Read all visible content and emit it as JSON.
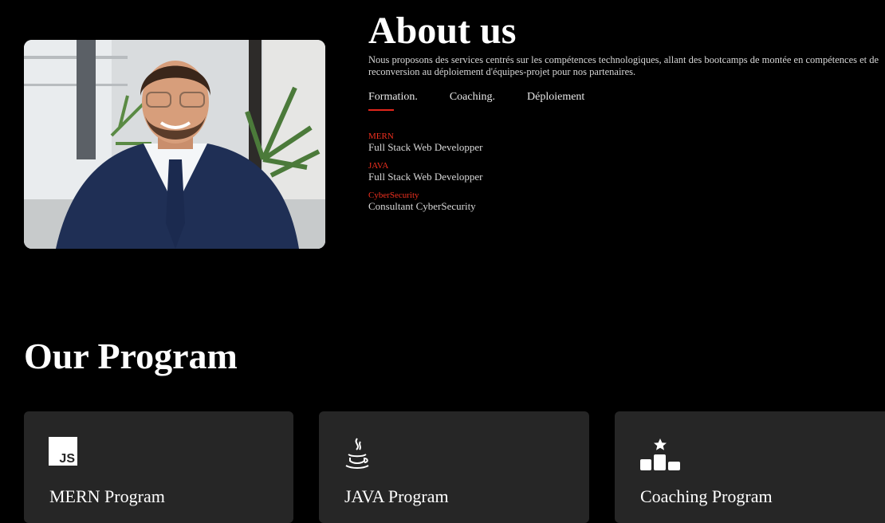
{
  "about": {
    "title": "About us",
    "description": "Nous proposons des services centrés sur les compétences technologiques, allant des bootcamps de montée en compétences et de reconversion au déploiement d'équipes-projet pour nos partenaires.",
    "tabs": [
      {
        "label": "Formation.",
        "active": true
      },
      {
        "label": "Coaching.",
        "active": false
      },
      {
        "label": "Déploiement",
        "active": false
      }
    ],
    "items": [
      {
        "tag": "MERN",
        "name": "Full Stack Web Developper"
      },
      {
        "tag": "JAVA",
        "name": "Full Stack Web Developper"
      },
      {
        "tag": "CyberSecurity",
        "name": "Consultant CyberSecurity"
      }
    ]
  },
  "program": {
    "title": "Our Program",
    "cards": [
      {
        "title": "MERN Program",
        "icon": "js-icon",
        "icon_text": "JS"
      },
      {
        "title": "JAVA Program",
        "icon": "java-coffee-icon"
      },
      {
        "title": "Coaching Program",
        "icon": "podium-star-icon"
      }
    ]
  },
  "colors": {
    "background": "#000000",
    "accent": "#e3261c",
    "card": "#262626"
  }
}
